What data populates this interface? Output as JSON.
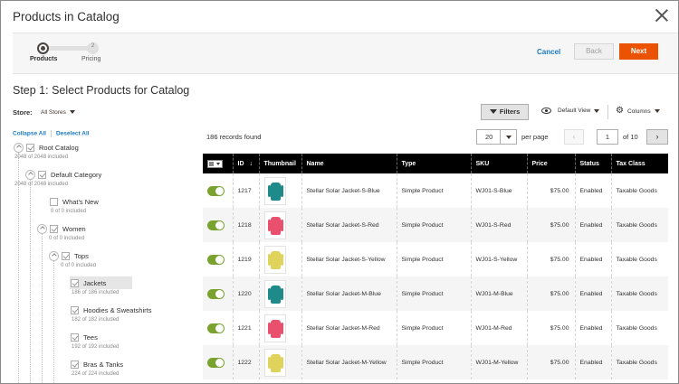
{
  "modal": {
    "title": "Products in Catalog"
  },
  "steps": [
    {
      "label": "Products",
      "number": "1",
      "active": true
    },
    {
      "label": "Pricing",
      "number": "2",
      "active": false
    }
  ],
  "actions": {
    "cancel": "Cancel",
    "back": "Back",
    "next": "Next"
  },
  "step_heading": "Step 1: Select Products for Catalog",
  "store": {
    "label": "Store:",
    "value": "All Stores"
  },
  "tree": {
    "collapse_all": "Collapse All",
    "deselect_all": "Deselect All",
    "nodes": [
      {
        "name": "Root Catalog",
        "meta": "2048 of 2048 included",
        "checked": true,
        "expandable": true
      },
      {
        "name": "Default Category",
        "meta": "2048 of 2048 included",
        "checked": true,
        "expandable": true
      },
      {
        "name": "What's New",
        "meta": "0 of 0 included",
        "checked": false,
        "expandable": false
      },
      {
        "name": "Women",
        "meta": "0 of 0 included",
        "checked": true,
        "expandable": true
      },
      {
        "name": "Tops",
        "meta": "0 of 0 included",
        "checked": true,
        "expandable": true
      },
      {
        "name": "Jackets",
        "meta": "186 of 186 included",
        "checked": true,
        "expandable": false,
        "selected": true
      },
      {
        "name": "Hoodies & Sweatshirts",
        "meta": "182 of 182 included",
        "checked": true,
        "expandable": false
      },
      {
        "name": "Tees",
        "meta": "192 of 192 included",
        "checked": true,
        "expandable": false
      },
      {
        "name": "Bras & Tanks",
        "meta": "224 of 224 included",
        "checked": true,
        "expandable": false
      }
    ]
  },
  "toolbar": {
    "filters": "Filters",
    "default_view": "Default View",
    "columns": "Columns",
    "records_found": "186 records found",
    "per_page_value": "20",
    "per_page_label": "per page",
    "prev_glyph": "‹",
    "next_glyph": "›",
    "current_page": "1",
    "page_total": "of 10"
  },
  "grid": {
    "headers": {
      "id": "ID",
      "id_sort": "↓",
      "thumbnail": "Thumbnail",
      "name": "Name",
      "type": "Type",
      "sku": "SKU",
      "price": "Price",
      "status": "Status",
      "tax_class": "Tax Class"
    },
    "rows": [
      {
        "id": "1217",
        "name": "Stellar Solar Jacket-S-Blue",
        "type": "Simple Product",
        "sku": "WJ01-S-Blue",
        "price": "$75.00",
        "status": "Enabled",
        "tax_class": "Taxable Goods",
        "color": "#1f8a8a"
      },
      {
        "id": "1218",
        "name": "Stellar Solar Jacket-S-Red",
        "type": "Simple Product",
        "sku": "WJ01-S-Red",
        "price": "$75.00",
        "status": "Enabled",
        "tax_class": "Taxable Goods",
        "color": "#e8506e"
      },
      {
        "id": "1219",
        "name": "Stellar Solar Jacket-S-Yellow",
        "type": "Simple Product",
        "sku": "WJ01-S-Yellow",
        "price": "$75.00",
        "status": "Enabled",
        "tax_class": "Taxable Goods",
        "color": "#e0d35c"
      },
      {
        "id": "1220",
        "name": "Stellar Solar Jacket-M-Blue",
        "type": "Simple Product",
        "sku": "WJ01-M-Blue",
        "price": "$75.00",
        "status": "Enabled",
        "tax_class": "Taxable Goods",
        "color": "#1f8a8a"
      },
      {
        "id": "1221",
        "name": "Stellar Solar Jacket-M-Red",
        "type": "Simple Product",
        "sku": "WJ01-M-Red",
        "price": "$75.00",
        "status": "Enabled",
        "tax_class": "Taxable Goods",
        "color": "#e8506e"
      },
      {
        "id": "1222",
        "name": "Stellar Solar Jacket-M-Yellow",
        "type": "Simple Product",
        "sku": "WJ01-M-Yellow",
        "price": "$75.00",
        "status": "Enabled",
        "tax_class": "Taxable Goods",
        "color": "#e0d35c"
      }
    ]
  },
  "colors": {
    "accent": "#eb5202",
    "link": "#1979c3",
    "toggle_on": "#79a22e",
    "header_bg": "#000000"
  }
}
